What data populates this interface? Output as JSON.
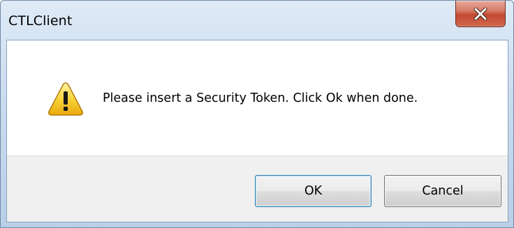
{
  "window": {
    "title": "CTLClient"
  },
  "dialog": {
    "icon": "warning-icon",
    "message": "Please insert a Security Token. Click Ok when done."
  },
  "buttons": {
    "ok_label": "OK",
    "cancel_label": "Cancel"
  },
  "colors": {
    "close_button": "#c9563d",
    "warning_yellow": "#f5c518",
    "focused_button_border": "#3c7fb1"
  }
}
